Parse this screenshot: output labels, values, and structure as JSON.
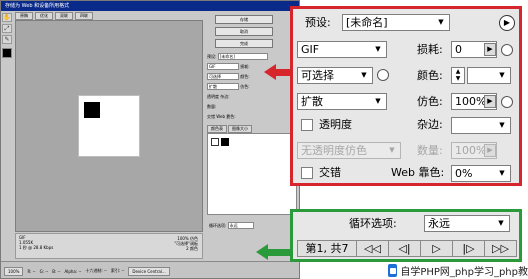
{
  "mini": {
    "title": "存储为 Web 和设备所用格式",
    "tabs": [
      "原稿",
      "优化",
      "双联",
      "四联"
    ],
    "tools": [
      "✋",
      "⤢",
      "✎"
    ],
    "buttons": [
      "存储",
      "取消",
      "完成"
    ],
    "preset_label": "预设:",
    "preset_value": "[未命名]",
    "format_value": "GIF",
    "reduction_value": "可选择",
    "dither_value": "扩散",
    "transparency_label": "透明度",
    "interlace_label": "交错",
    "lossy_label": "损耗:",
    "colors_label": "颜色:",
    "dither_pct_label": "仿色:",
    "matte_label": "杂边:",
    "amount_label": "数量:",
    "web_snap_label": "Web 靠色:",
    "palette_tabs": [
      "颜色表",
      "图像大小"
    ],
    "loop_label": "循环选项:",
    "loop_value": "永远",
    "info_left": [
      "GIF",
      "1.055K",
      "1 秒 @ 28.8 Kbps"
    ],
    "info_right": [
      "100% 仿色",
      "\"可选择\"调板",
      "2 颜色"
    ],
    "status_items": [
      "100%",
      "R: --",
      "G: --",
      "B: --",
      "Alpha: --",
      "十六进制: --",
      "索引: --"
    ],
    "device_central": "Device Central..."
  },
  "settings_panel": {
    "preset_label": "预设:",
    "preset_value": "[未命名]",
    "format_value": "GIF",
    "lossy_label": "损耗:",
    "lossy_value": "0",
    "reduction_value": "可选择",
    "colors_label": "颜色:",
    "dither_algorithm_value": "扩散",
    "dither_label": "仿色:",
    "dither_value": "100%",
    "transparency_label": "透明度",
    "matte_label": "杂边:",
    "transparency_dither_value": "无透明度仿色",
    "amount_label": "数量:",
    "amount_value": "100%",
    "interlaced_label": "交错",
    "web_snap_label": "Web 靠色:",
    "web_snap_value": "0%"
  },
  "animation_panel": {
    "loop_label": "循环选项:",
    "loop_value": "永远",
    "frame_status": "第1, 共7",
    "nav_buttons": [
      "◁◁",
      "◁|",
      "▷",
      "|▷",
      "▷▷"
    ]
  },
  "watermark": {
    "text": "自学PHP网_php学习_php教"
  },
  "colors": {
    "top_callout_border": "#d6262c",
    "bottom_callout_border": "#2b9a3a"
  }
}
